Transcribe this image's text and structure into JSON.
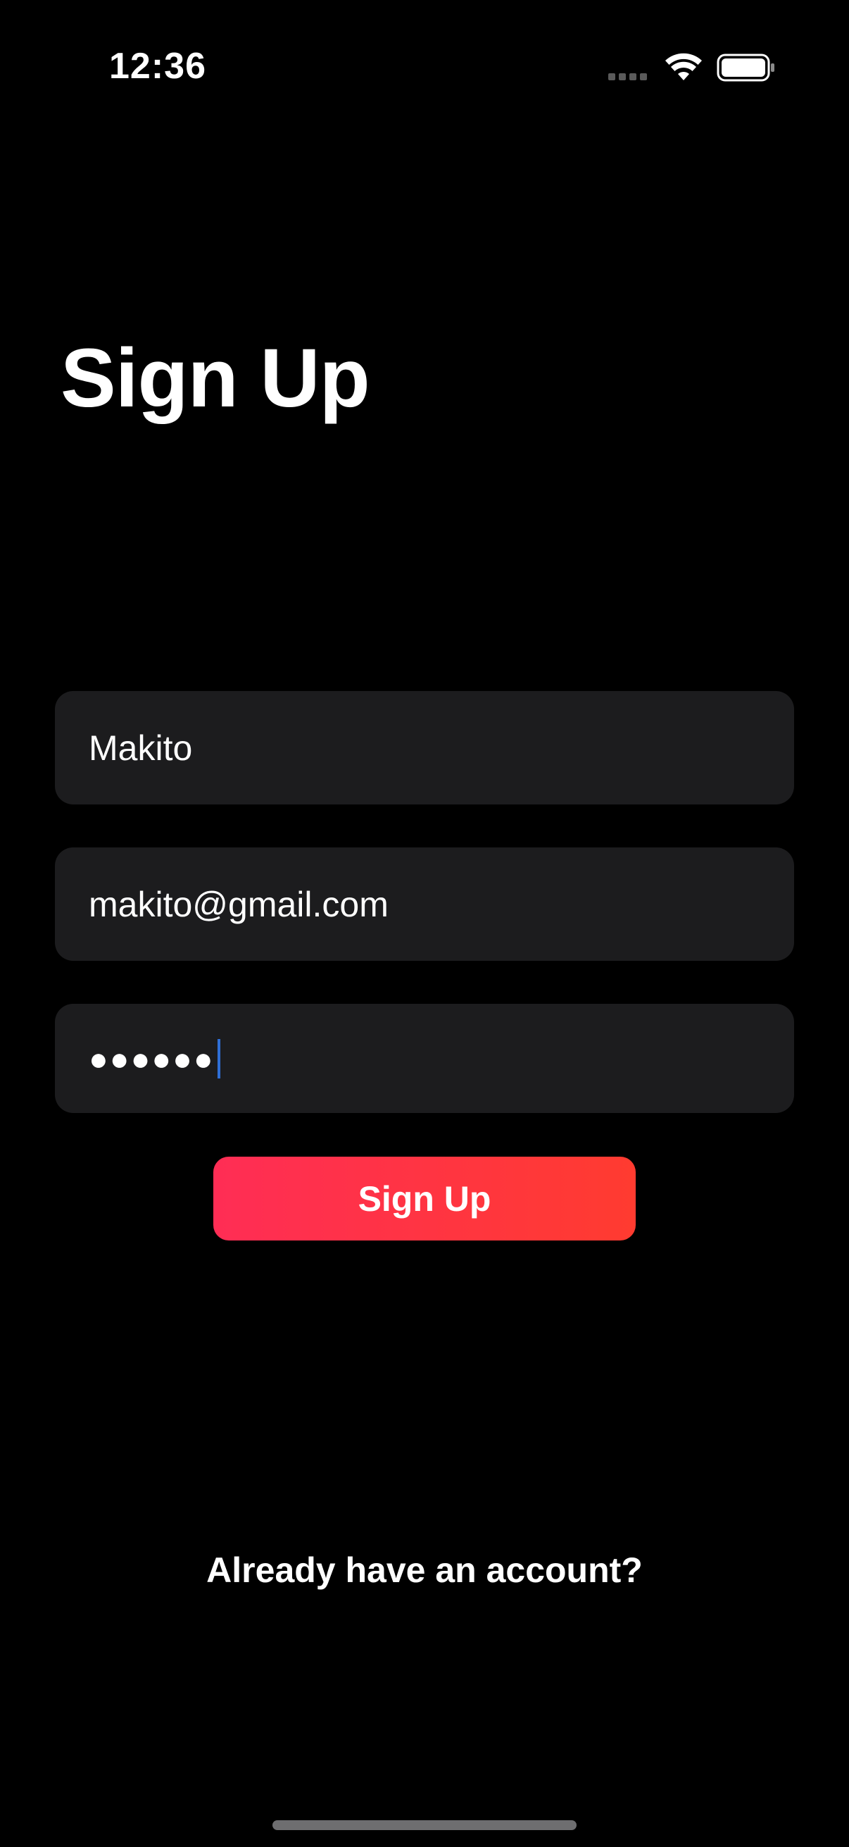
{
  "status_bar": {
    "time": "12:36",
    "icons": [
      "cellular-dots-icon",
      "wifi-icon",
      "battery-icon"
    ]
  },
  "title": "Sign Up",
  "form": {
    "name_value": "Makito",
    "email_value": "makito@gmail.com",
    "password_masked": "●●●●●●",
    "submit_label": "Sign Up"
  },
  "footer": {
    "login_link_label": "Already have an account?"
  },
  "colors": {
    "background": "#000000",
    "field_background": "#1c1c1e",
    "button_gradient_start": "#ff2d55",
    "button_gradient_end": "#ff3b30",
    "caret": "#2f6fd6"
  }
}
